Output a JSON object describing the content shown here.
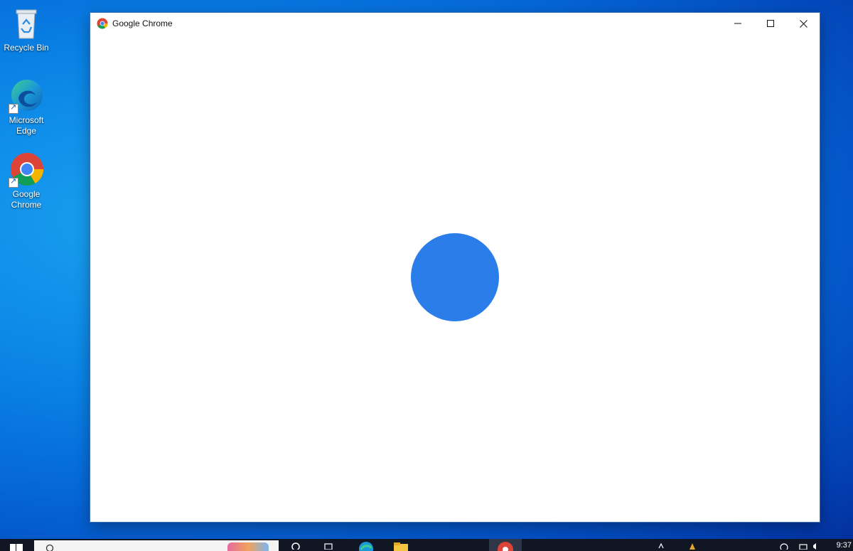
{
  "desktop": {
    "icons": [
      {
        "label": "Recycle Bin"
      },
      {
        "label": "Microsoft\nEdge"
      },
      {
        "label": "Google\nChrome"
      }
    ]
  },
  "window": {
    "title": "Google Chrome",
    "accent": "#2b7de9"
  },
  "taskbar": {
    "clock": "9:37"
  }
}
